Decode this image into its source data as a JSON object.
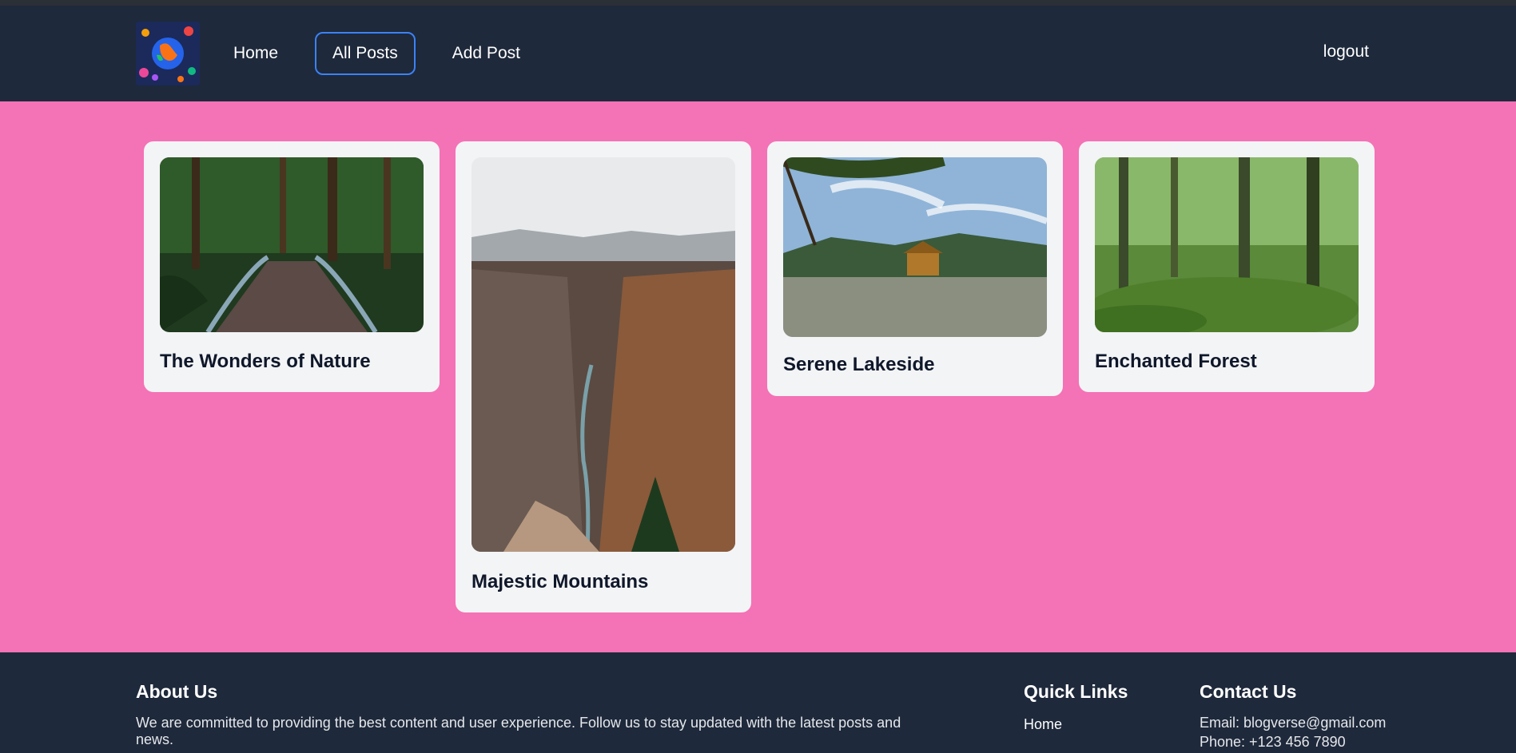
{
  "nav": {
    "logo_icon": "globe-logo-icon",
    "items": [
      {
        "label": "Home"
      },
      {
        "label": "All Posts"
      },
      {
        "label": "Add Post"
      }
    ],
    "logout": "logout"
  },
  "posts": [
    {
      "title": "The Wonders of Nature",
      "image": "bridge-forest-image"
    },
    {
      "title": "Majestic Mountains",
      "image": "canyon-mountains-image"
    },
    {
      "title": "Serene Lakeside",
      "image": "lakeside-pavilion-image"
    },
    {
      "title": "Enchanted Forest",
      "image": "mossy-forest-image"
    }
  ],
  "footer": {
    "about": {
      "title": "About Us",
      "text": "We are committed to providing the best content and user experience. Follow us to stay updated with the latest posts and news."
    },
    "links": {
      "title": "Quick Links",
      "items": [
        "Home"
      ]
    },
    "contact": {
      "title": "Contact Us",
      "email": "Email: blogverse@gmail.com",
      "phone": "Phone: +123 456 7890"
    }
  },
  "colors": {
    "header": "#1e293b",
    "page_bg": "#f472b6",
    "card": "#f3f4f6",
    "active_border": "#3b82f6"
  }
}
